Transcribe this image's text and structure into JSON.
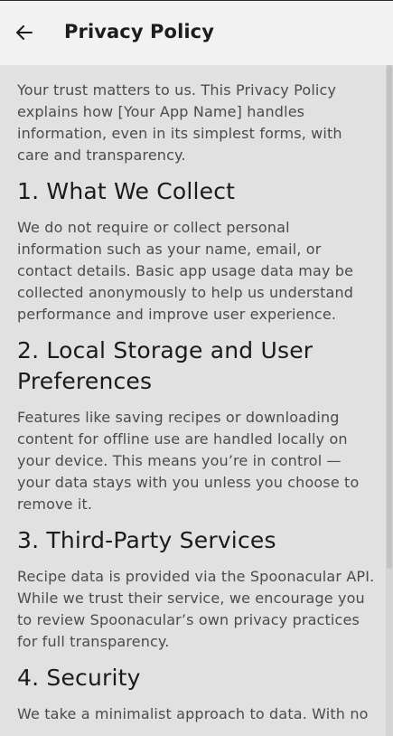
{
  "appbar": {
    "title": "Privacy Policy",
    "back_icon": "arrow-left-icon"
  },
  "policy": {
    "intro": "Your trust matters to us. This Privacy Policy explains how [Your App Name] handles information, even in its simplest forms, with care and transparency.",
    "sections": [
      {
        "heading": "1. What We Collect",
        "body": "We do not require or collect personal information such as your name, email, or contact details. Basic app usage data may be collected anonymously to help us understand performance and improve user experience."
      },
      {
        "heading": "2. Local Storage and User Preferences",
        "body": "Features like saving recipes or downloading content for offline use are handled locally on your device. This means you’re in control — your data stays with you unless you choose to remove it."
      },
      {
        "heading": "3. Third-Party Services",
        "body": "Recipe data is provided via the Spoonacular API. While we trust their service, we encourage you to review Spoonacular’s own privacy practices for full transparency."
      },
      {
        "heading": "4. Security",
        "body": "We take a minimalist approach to data. With no"
      }
    ]
  },
  "colors": {
    "appbar_bg": "#f2f2f2",
    "content_bg": "#e1e1e1",
    "heading_text": "#1b1b1b",
    "body_text": "#4b4b4b"
  }
}
